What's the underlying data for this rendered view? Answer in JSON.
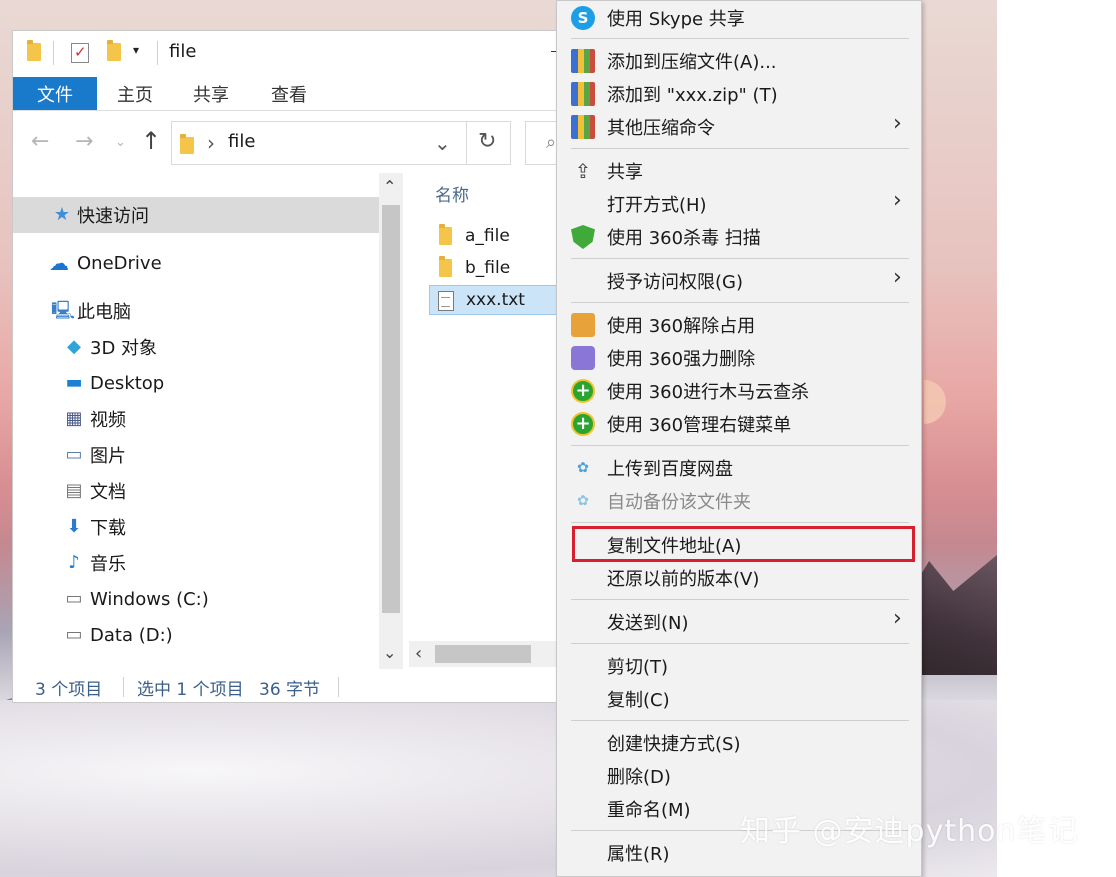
{
  "window": {
    "title": "file",
    "ribbon_tabs": [
      "文件",
      "主页",
      "共享",
      "查看"
    ],
    "address_path": "file",
    "nav_up": "↑"
  },
  "nav_pane": {
    "items": [
      {
        "label": "快速访问",
        "icon": "star-icon"
      },
      {
        "label": "OneDrive",
        "icon": "cloud-icon"
      },
      {
        "label": "此电脑",
        "icon": "computer-icon"
      },
      {
        "label": "3D 对象",
        "icon": "cube-icon"
      },
      {
        "label": "Desktop",
        "icon": "desktop-icon"
      },
      {
        "label": "视频",
        "icon": "video-icon"
      },
      {
        "label": "图片",
        "icon": "picture-icon"
      },
      {
        "label": "文档",
        "icon": "document-icon"
      },
      {
        "label": "下载",
        "icon": "download-icon"
      },
      {
        "label": "音乐",
        "icon": "music-icon"
      },
      {
        "label": "Windows (C:)",
        "icon": "drive-c-icon"
      },
      {
        "label": "Data (D:)",
        "icon": "drive-d-icon"
      }
    ]
  },
  "content": {
    "column_header": "名称",
    "files": [
      {
        "name": "a_file",
        "type": "folder"
      },
      {
        "name": "b_file",
        "type": "folder"
      },
      {
        "name": "xxx.txt",
        "type": "text",
        "selected": true
      }
    ]
  },
  "status": {
    "item_count": "3 个项目",
    "selection": "选中 1 个项目",
    "size": "36 字节"
  },
  "context_menu": {
    "items": [
      {
        "label": "使用 Skype 共享"
      },
      {
        "label": "添加到压缩文件(A)..."
      },
      {
        "label": "添加到 \"xxx.zip\" (T)"
      },
      {
        "label": "其他压缩命令"
      },
      {
        "label": "共享"
      },
      {
        "label": "打开方式(H)"
      },
      {
        "label": "使用 360杀毒 扫描"
      },
      {
        "label": "授予访问权限(G)"
      },
      {
        "label": "使用 360解除占用"
      },
      {
        "label": "使用 360强力删除"
      },
      {
        "label": "使用 360进行木马云查杀"
      },
      {
        "label": "使用 360管理右键菜单"
      },
      {
        "label": "上传到百度网盘"
      },
      {
        "label": "自动备份该文件夹",
        "disabled": true
      },
      {
        "label": "复制文件地址(A)",
        "highlighted": true
      },
      {
        "label": "还原以前的版本(V)"
      },
      {
        "label": "发送到(N)"
      },
      {
        "label": "剪切(T)"
      },
      {
        "label": "复制(C)"
      },
      {
        "label": "创建快捷方式(S)"
      },
      {
        "label": "删除(D)"
      },
      {
        "label": "重命名(M)"
      },
      {
        "label": "属性(R)"
      }
    ],
    "highlight_color": "#d6202d"
  },
  "watermark": "知乎 @安迪python笔记"
}
